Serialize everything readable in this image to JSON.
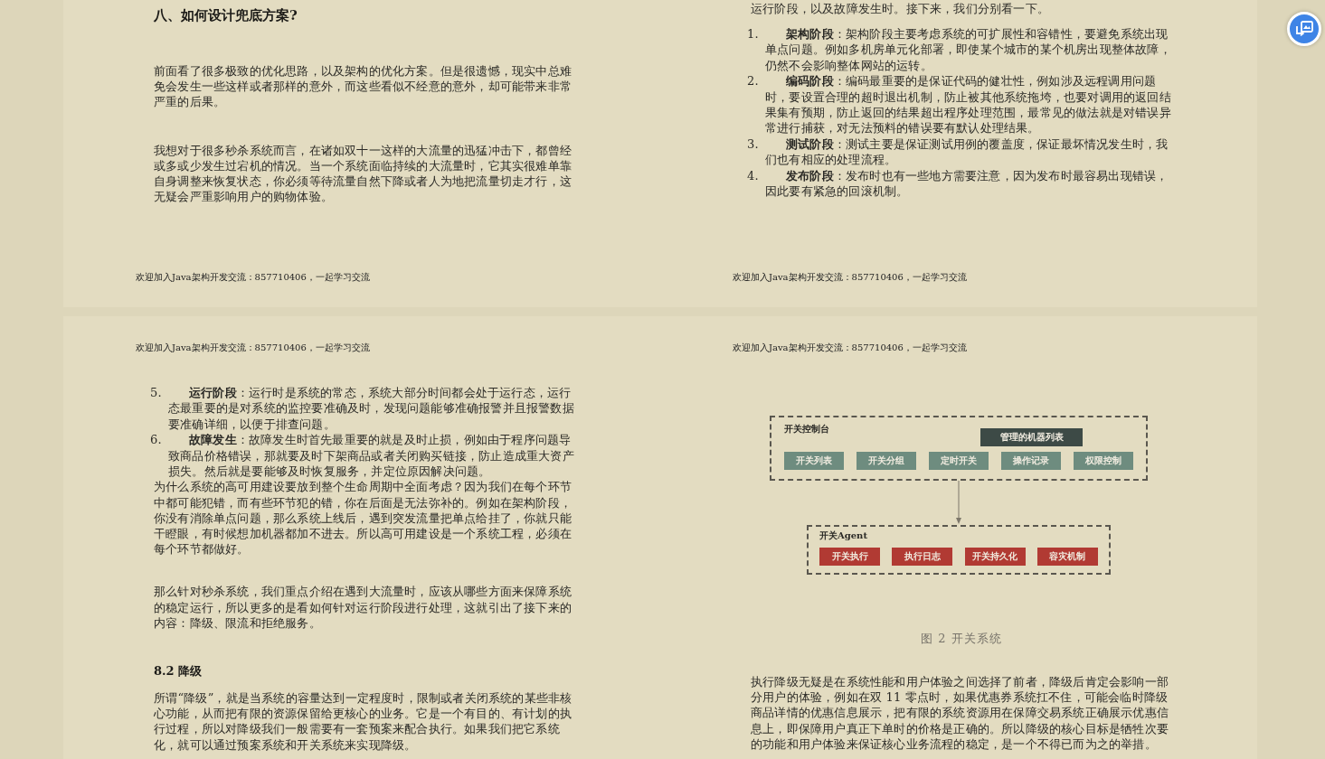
{
  "pages": [
    {
      "blocks": [
        {
          "kind": "heading",
          "text": "八、如何设计兜底方案?"
        },
        {
          "kind": "paragraph",
          "text": "前面看了很多极致的优化思路，以及架构的优化方案。但是很遗憾，现实中总难免会发生一些这样或者那样的意外，而这些看似不经意的意外，却可能带来非常严重的后果。"
        },
        {
          "kind": "paragraph",
          "text": "我想对于很多秒杀系统而言，在诸如双十一这样的大流量的迅猛冲击下，都曾经或多或少发生过宕机的情况。当一个系统面临持续的大流量时，它其实很难单靠自身调整来恢复状态，你必须等待流量自然下降或者人为地把流量切走才行，这无疑会严重影响用户的购物体验。"
        }
      ],
      "footer": "欢迎加入Java架构开发交流：857710406，一起学习交流"
    },
    {
      "blocks": [
        {
          "kind": "cut_line",
          "text": "运行阶段，以及故障发生时。接下来，我们分别看一下。"
        },
        {
          "kind": "list_item",
          "number": "1.",
          "text": "**架构阶段**：架构阶段主要考虑系统的可扩展性和容错性，要避免系统出现单点问题。例如多机房单元化部署，即使某个城市的某个机房出现整体故障，仍然不会影响整体网站的运转。"
        },
        {
          "kind": "list_item",
          "number": "2.",
          "text": "**编码阶段**：编码最重要的是保证代码的健壮性，例如涉及远程调用问题时，要设置合理的超时退出机制，防止被其他系统拖垮，也要对调用的返回结果集有预期，防止返回的结果超出程序处理范围，最常见的做法就是对错误异常进行捕获，对无法预料的错误要有默认处理结果。"
        },
        {
          "kind": "list_item",
          "number": "3.",
          "text": "**测试阶段**：测试主要是保证测试用例的覆盖度，保证最坏情况发生时，我们也有相应的处理流程。"
        },
        {
          "kind": "list_item",
          "number": "4.",
          "text": "**发布阶段**：发布时也有一些地方需要注意，因为发布时最容易出现错误，因此要有紧急的回滚机制。"
        }
      ],
      "footer": "欢迎加入Java架构开发交流：857710406，一起学习交流"
    },
    {
      "header": "欢迎加入Java架构开发交流：857710406，一起学习交流",
      "blocks": [
        {
          "kind": "list_item",
          "number": "5.",
          "text": "**运行阶段**：运行时是系统的常态，系统大部分时间都会处于运行态，运行态最重要的是对系统的监控要准确及时，发现问题能够准确报警并且报警数据要准确详细，以便于排查问题。"
        },
        {
          "kind": "list_item",
          "number": "6.",
          "text": "**故障发生**：故障发生时首先最重要的就是及时止损，例如由于程序问题导致商品价格错误，那就要及时下架商品或者关闭购买链接，防止造成重大资产损失。然后就是要能够及时恢复服务，并定位原因解决问题。"
        },
        {
          "kind": "tight_paragraph",
          "text": "为什么系统的高可用建设要放到整个生命周期中全面考虑？因为我们在每个环节中都可能犯错，而有些环节犯的错，你在后面是无法弥补的。例如在架构阶段，你没有消除单点问题，那么系统上线后，遇到突发流量把单点给挂了，你就只能干瞪眼，有时候想加机器都加不进去。所以高可用建设是一个系统工程，必须在每个环节都做好。"
        },
        {
          "kind": "paragraph",
          "text": "那么针对秒杀系统，我们重点介绍在遇到大流量时，应该从哪些方面来保障系统的稳定运行，所以更多的是看如何针对运行阶段进行处理，这就引出了接下来的内容：降级、限流和拒绝服务。"
        },
        {
          "kind": "subheading",
          "text": "8.2 降级"
        },
        {
          "kind": "paragraph",
          "text": "所谓“降级”，就是当系统的容量达到一定程度时，限制或者关闭系统的某些非核心功能，从而把有限的资源保留给更核心的业务。它是一个有目的、有计划的执行过程，所以对降级我们一般需要有一套预案来配合执行。如果我们把它系统化，就可以通过预案系统和开关系统来实现降级。"
        }
      ]
    },
    {
      "header": "欢迎加入Java架构开发交流：857710406，一起学习交流",
      "blocks": [
        {
          "kind": "figure",
          "console": {
            "label": "开关控制台",
            "machine_list": "管理的机器列表",
            "modules": [
              "开关列表",
              "开关分组",
              "定时开关",
              "操作记录",
              "权限控制"
            ]
          },
          "agent": {
            "label": "开关Agent",
            "modules": [
              "开关执行",
              "执行日志",
              "开关持久化",
              "容灾机制"
            ]
          }
        },
        {
          "kind": "caption",
          "text": "图 2 开关系统"
        },
        {
          "kind": "paragraph",
          "text": "执行降级无疑是在系统性能和用户体验之间选择了前者，降级后肯定会影响一部分用户的体验，例如在双 11 零点时，如果优惠券系统扛不住，可能会临时降级商品详情的优惠信息展示，把有限的系统资源用在保障交易系统正确展示优惠信息上，即保障用户真正下单时的价格是正确的。所以降级的核心目标是牺牲次要的功能和用户体验来保证核心业务流程的稳定，是一个不得已而为之的举措。"
        }
      ]
    }
  ]
}
